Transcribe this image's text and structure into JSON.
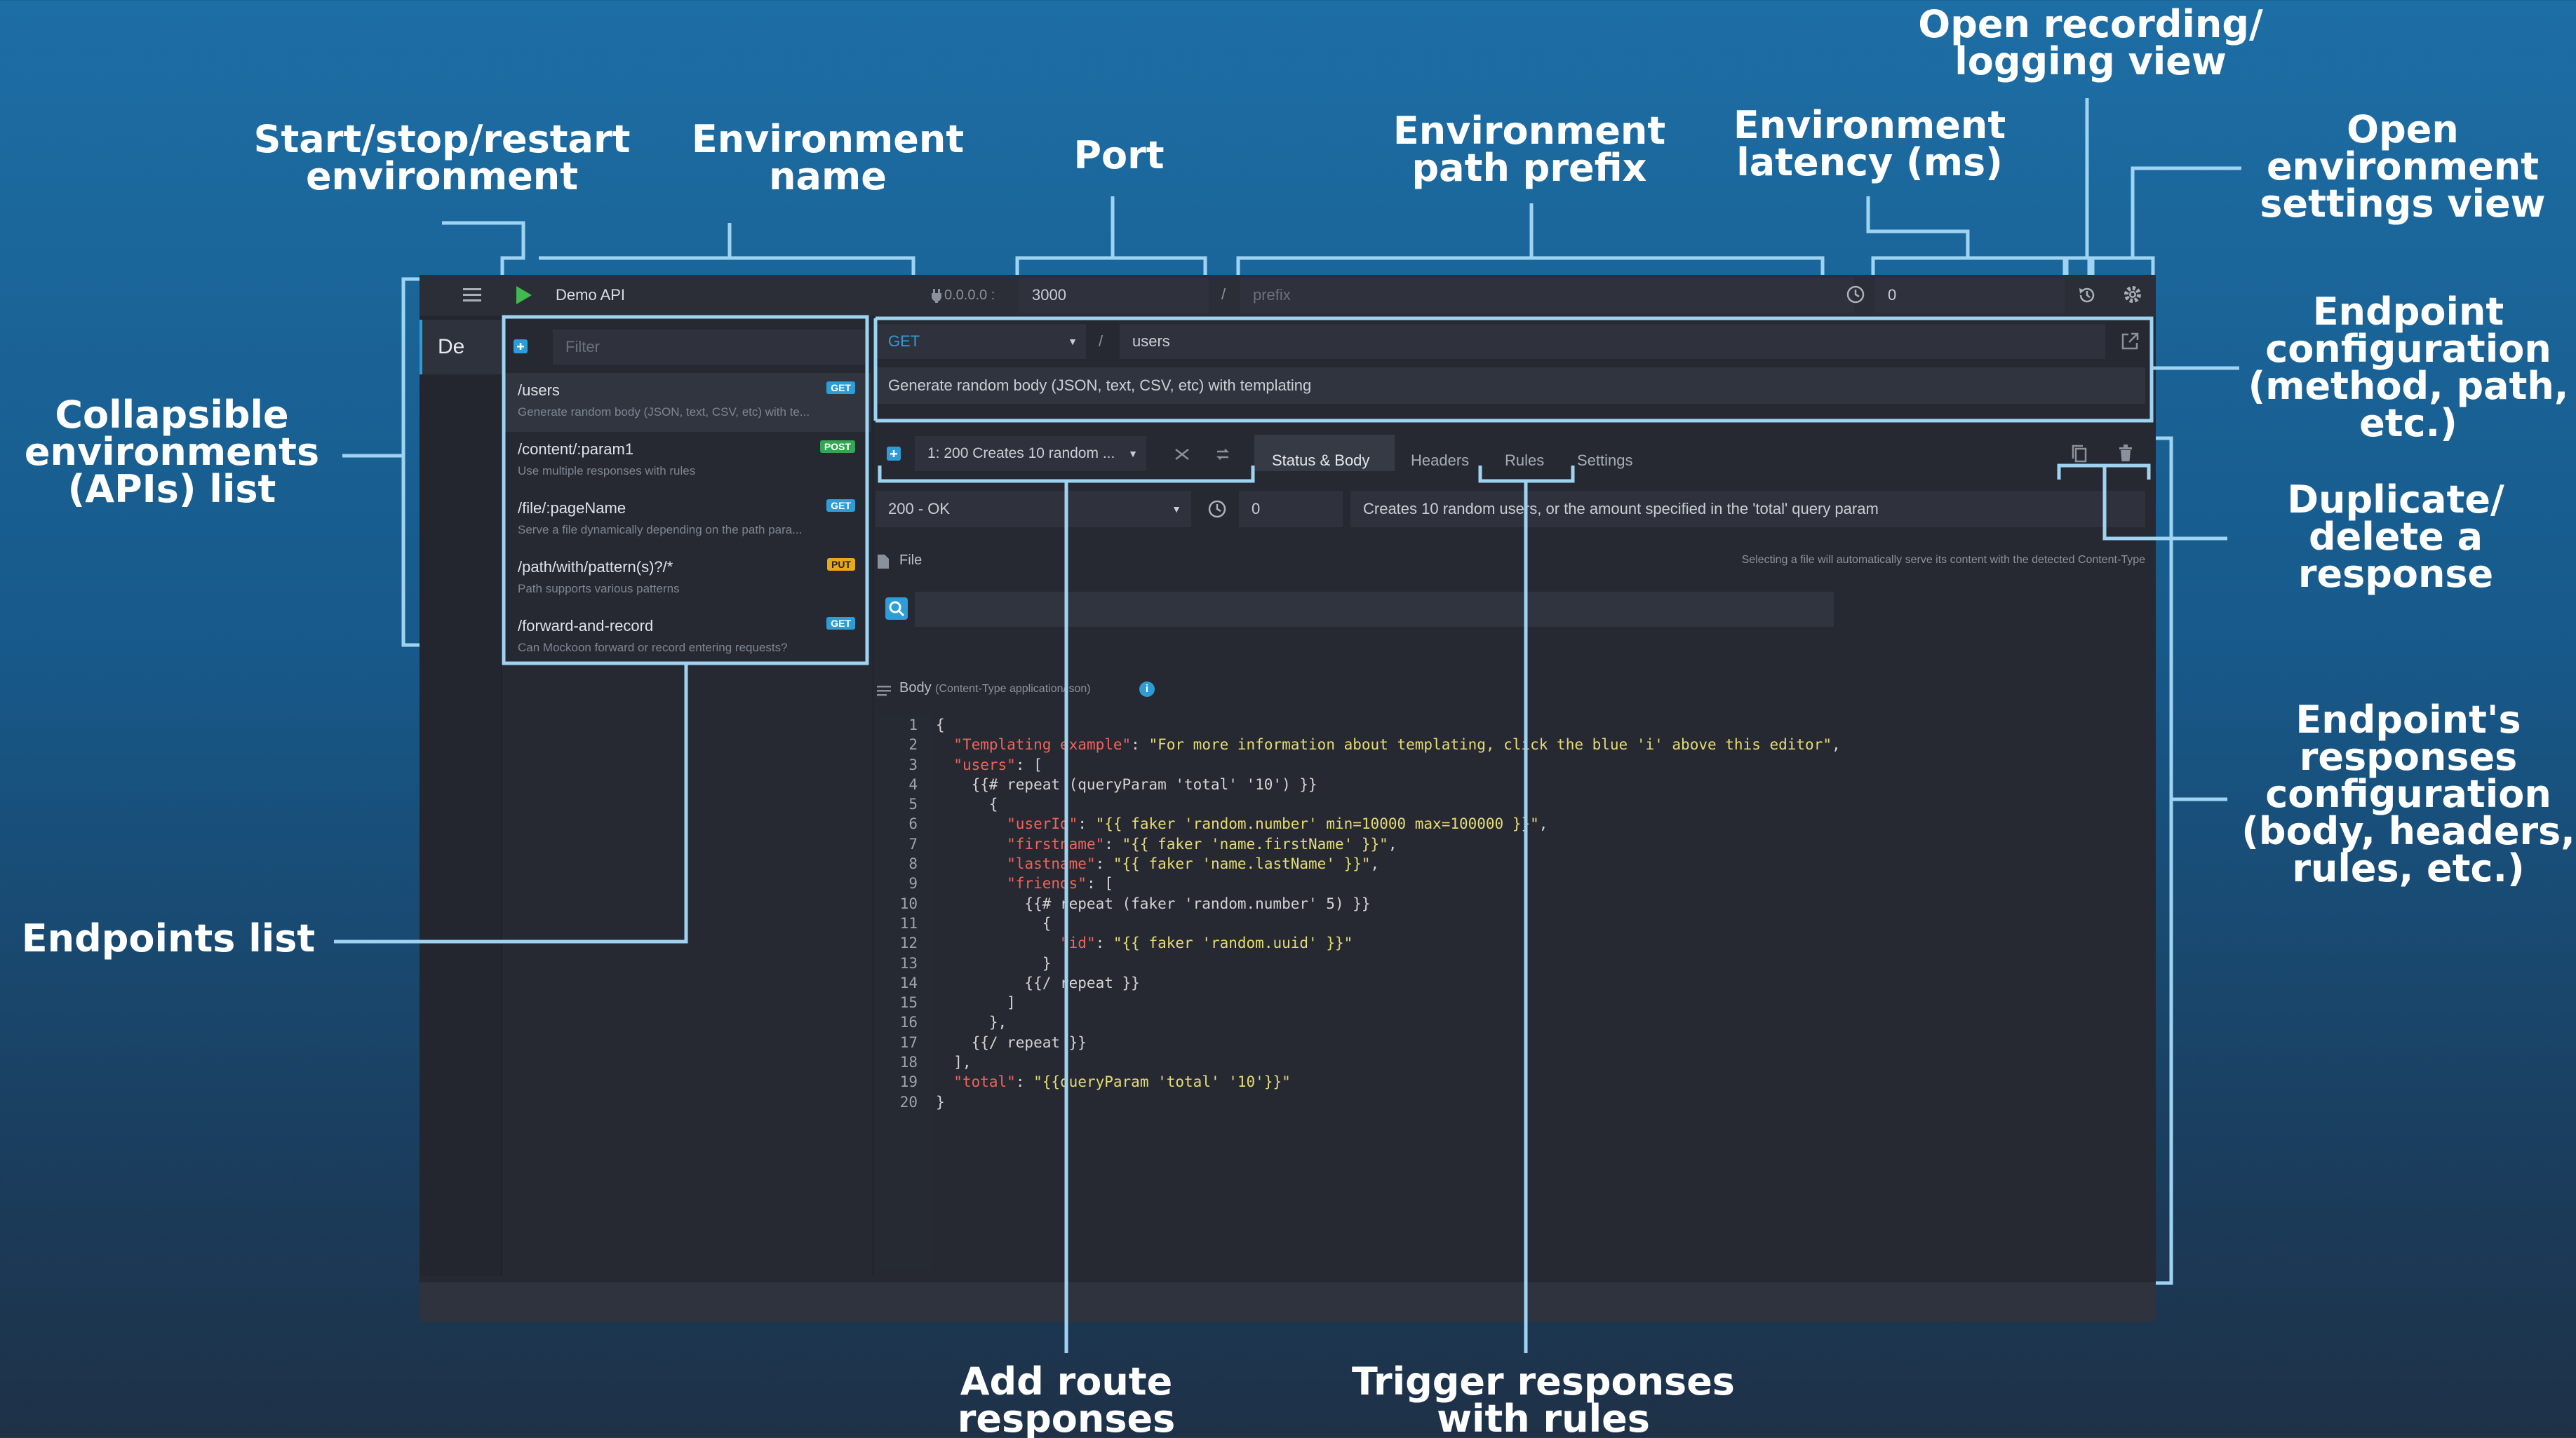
{
  "annotations": {
    "start_stop": "Start/stop/restart\nenvironment",
    "env_name": "Environment\nname",
    "port": "Port",
    "path_prefix": "Environment\npath prefix",
    "latency": "Environment\nlatency (ms)",
    "recording": "Open recording/\nlogging view",
    "env_settings": "Open\nenvironment\nsettings view",
    "collapsible": "Collapsible\nenvironments\n(APIs) list",
    "endpoint_config": "Endpoint\nconfiguration\n(method, path,\netc.)",
    "dup_delete": "Duplicate/\ndelete a\nresponse",
    "responses_config": "Endpoint's\nresponses\nconfiguration\n(body, headers,\nrules, etc.)",
    "endpoints_list": "Endpoints list",
    "add_route": "Add route\nresponses",
    "trigger_rules": "Trigger responses\nwith rules"
  },
  "header": {
    "menu_icon": "hamburger-icon",
    "play_icon": "play-icon",
    "env_name": "Demo API",
    "host": "0.0.0.0 :",
    "port": "3000",
    "slash": "/",
    "prefix_placeholder": "prefix",
    "latency": "0"
  },
  "sidebar": {
    "env_abbrev": "De"
  },
  "endpoints": {
    "filter_placeholder": "Filter",
    "items": [
      {
        "path": "/users",
        "desc": "Generate random body (JSON, text, CSV, etc) with te...",
        "method": "GET"
      },
      {
        "path": "/content/:param1",
        "desc": "Use multiple responses with rules",
        "method": "POST"
      },
      {
        "path": "/file/:pageName",
        "desc": "Serve a file dynamically depending on the path para...",
        "method": "GET"
      },
      {
        "path": "/path/with/pattern(s)?/*",
        "desc": "Path supports various patterns",
        "method": "PUT"
      },
      {
        "path": "/forward-and-record",
        "desc": "Can Mockoon forward or record entering requests?",
        "method": "GET"
      }
    ]
  },
  "route": {
    "method": "GET",
    "slash": "/",
    "path": "users",
    "description": "Generate random body (JSON, text, CSV, etc) with templating"
  },
  "response": {
    "selector": "1: 200   Creates 10 random ...",
    "tabs": [
      "Status & Body",
      "Headers",
      "Rules",
      "Settings"
    ],
    "status": "200 - OK",
    "latency": "0",
    "description": "Creates 10 random users, or the amount specified in the 'total' query param",
    "file_label": "File",
    "file_hint": "Selecting a file will automatically serve its content with the detected Content-Type",
    "body_label": "Body",
    "body_ct": "(Content-Type application/json)"
  },
  "colors": {
    "accent": "#2e9cd7",
    "play": "#3fb950",
    "key": "#f0635a",
    "string": "#e6db74"
  }
}
